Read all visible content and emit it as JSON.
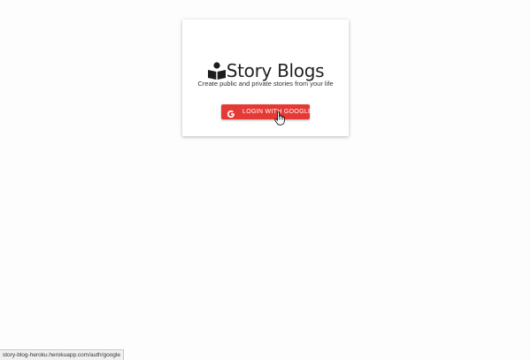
{
  "app": {
    "title": "Story Blogs",
    "tagline": "Create public and private stories from your life",
    "brand_icon": "reading-person-icon"
  },
  "login": {
    "button_label": "LOGIN WITH GOOGLE",
    "button_icon": "google-icon",
    "button_color": "#e53935"
  },
  "status_bar": {
    "url": "story-blog-heroku.herokuapp.com/auth/google"
  },
  "cursor": {
    "icon": "hand-pointer-icon"
  }
}
